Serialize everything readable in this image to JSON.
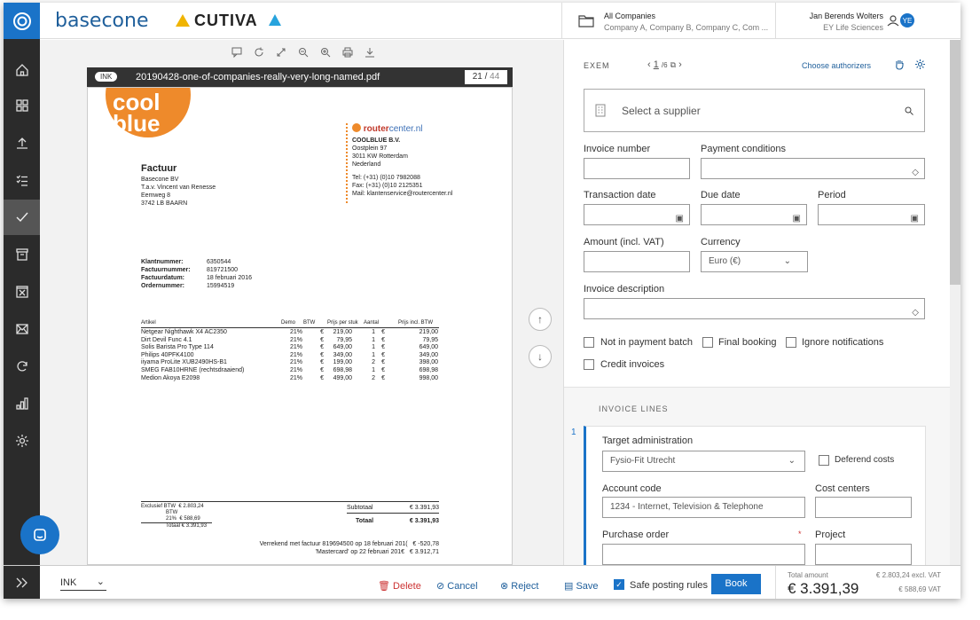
{
  "app": {
    "brand": "basecone",
    "partner": "CUTIVA"
  },
  "company": {
    "title": "All Companies",
    "subtitle": "Company A, Company B, Company C, Com ..."
  },
  "user": {
    "name": "Jan Berends Wolters",
    "org": "EY Life Sciences",
    "initials": "YE"
  },
  "pdf": {
    "tag": "INK",
    "filename": "20190428-one-of-companies-really-very-long-named.pdf",
    "page": "21",
    "total": "44"
  },
  "invoice_doc": {
    "logo_top": "cool",
    "logo_bottom": "blue",
    "vendor_brand_1": "router",
    "vendor_brand_2": "center.nl",
    "vendor_lines": [
      "COOLBLUE B.V.",
      "Oostplein 97",
      "3011 KW  Rotterdam",
      "Nederland"
    ],
    "vendor_contact": [
      "Tel:   (+31) (0)10 7982088",
      "Fax:  (+31) (0)10 2125351",
      "Mail:  klantenservice@routercenter.nl"
    ],
    "title": "Factuur",
    "address": [
      "Basecone BV",
      "T.a.v. Vincent van Renesse",
      "Eemweg 8",
      "3742 LB  BAARN"
    ],
    "meta_labels": [
      "Klantnummer:",
      "Factuurnummer:",
      "Factuurdatum:",
      "Ordernummer:"
    ],
    "meta_values": [
      "6350544",
      "819721500",
      "18 februari 2016",
      "15994519"
    ],
    "table_headers": [
      "Artikel",
      "Demo",
      "BTW",
      "Prijs per stuk",
      "Aantal",
      "Prijs incl. BTW"
    ],
    "rows": [
      [
        "Netgear Nighthawk X4 AC2350",
        "21%",
        "€",
        "219,00",
        "1",
        "€",
        "219,00"
      ],
      [
        "Dirt Devil Func 4.1",
        "21%",
        "€",
        "79,95",
        "1",
        "€",
        "79,95"
      ],
      [
        "Solis Barista Pro Type 114",
        "21%",
        "€",
        "649,00",
        "1",
        "€",
        "649,00"
      ],
      [
        "Philips 40PFK4100",
        "21%",
        "€",
        "349,00",
        "1",
        "€",
        "349,00"
      ],
      [
        "iiyama ProLite XUB2490HS-B1",
        "21%",
        "€",
        "199,00",
        "2",
        "€",
        "398,00"
      ],
      [
        "SMEG FAB10HRNE (rechtsdraaiend)",
        "21%",
        "€",
        "698,98",
        "1",
        "€",
        "698,98"
      ],
      [
        "Medion Akoya E2098",
        "21%",
        "€",
        "499,00",
        "2",
        "€",
        "998,00"
      ]
    ],
    "excl_label": "Exclusief BTW",
    "excl_val": "€ 2.803,24",
    "btw_label": "BTW",
    "btw_pct": "21%",
    "btw_val": "€   588,69",
    "totaal_small": "Totaal",
    "totaal_small_val": "€ 3.391,93",
    "subtotaal_label": "Subtotaal",
    "subtotaal_val": "€       3.391,93",
    "totaal_label": "Totaal",
    "totaal_val": "€       3.391,93",
    "verrekend_1": "Verrekend met factuur 819694500 op 18 februari 201(",
    "verrekend_1_val": "€       -520,78",
    "verrekend_2": "'Mastercard' op 22 februari 201€",
    "verrekend_2_val": "€    3.912,71"
  },
  "form": {
    "exem": "EXEM",
    "pager_cur": "1",
    "pager_total": "/6",
    "choose": "Choose authorizers",
    "supplier_placeholder": "Select a supplier",
    "invoice_number": "Invoice number",
    "payment_conditions": "Payment conditions",
    "transaction_date": "Transaction date",
    "due_date": "Due date",
    "period": "Period",
    "amount": "Amount (incl. VAT)",
    "currency": "Currency",
    "currency_value": "Euro (€)",
    "description": "Invoice description",
    "cb_payment_batch": "Not in payment batch",
    "cb_final": "Final booking",
    "cb_ignore": "Ignore notifications",
    "cb_credit": "Credit invoices",
    "lines_title": "INVOICE LINES",
    "line_no": "1",
    "target_admin": "Target administration",
    "target_value": "Fysio-Fit Utrecht",
    "deferred": "Deferend costs",
    "account_code": "Account code",
    "account_value": "1234 - Internet, Television & Telephone",
    "cost_centers": "Cost centers",
    "purchase_order": "Purchase order",
    "required_mark": "*",
    "project": "Project"
  },
  "footer": {
    "ink": "INK",
    "delete": "Delete",
    "cancel": "Cancel",
    "reject": "Reject",
    "save": "Save",
    "safe_posting": "Safe posting rules",
    "book": "Book",
    "total_label": "Total amount",
    "total": "€ 3.391,39",
    "excl": "€ 2.803,24 excl. VAT",
    "vat": "€ 588,69 VAT"
  },
  "colors": {
    "accent": "#1a73c8",
    "danger": "#cc3333",
    "sidebar": "#2b2b2b"
  }
}
